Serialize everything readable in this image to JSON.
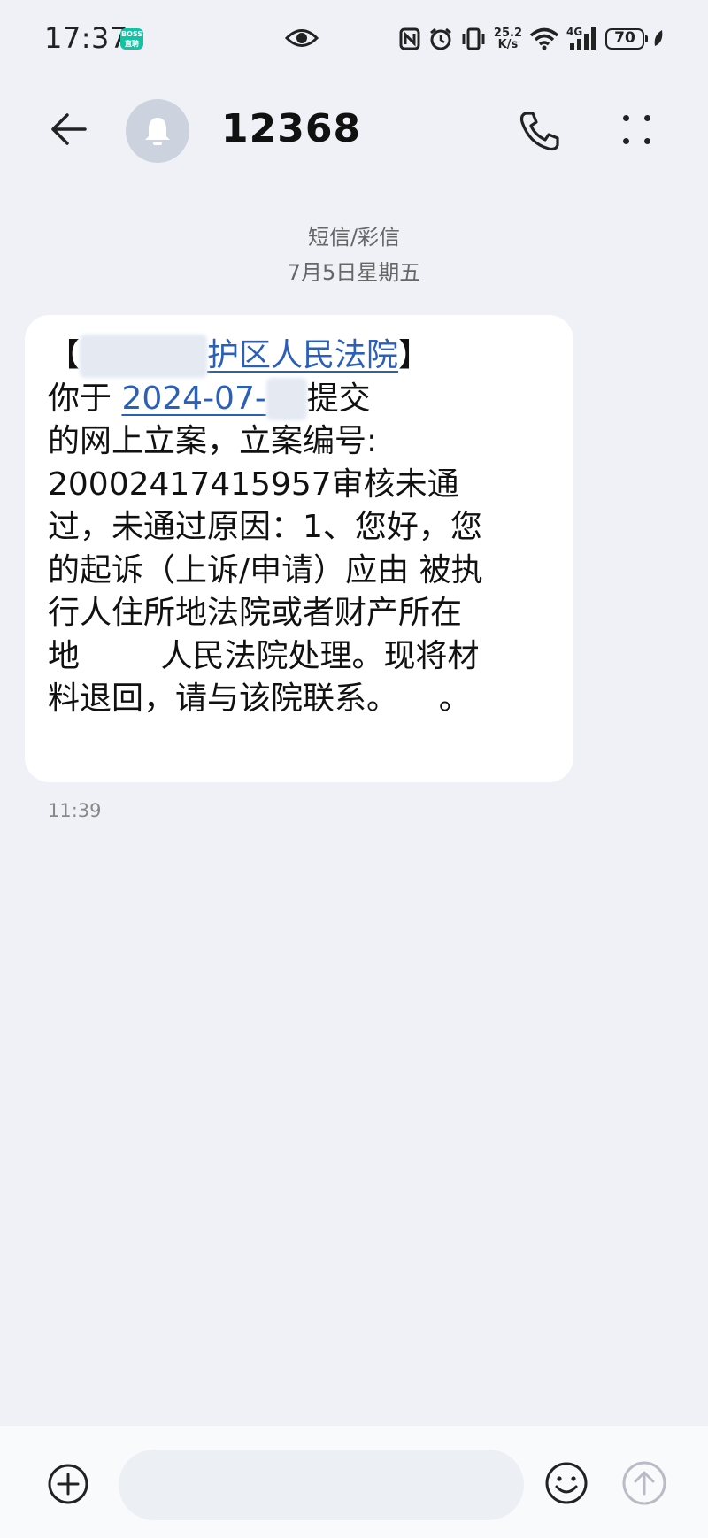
{
  "status_bar": {
    "time": "17:37",
    "app_badge": "BOSS\n直聘",
    "net_speed_value": "25.2",
    "net_speed_unit": "K/s",
    "network": "4G",
    "battery": "70"
  },
  "header": {
    "contact": "12368"
  },
  "conversation": {
    "type_label": "短信/彩信",
    "date_label": "7月5日星期五"
  },
  "message": {
    "line1_open": "【",
    "line1_court": "护区人民法院",
    "line1_close": "】",
    "line2_prefix": "你于 ",
    "line2_date": "2024-07-",
    "line2_suffix": "提交",
    "line3": "的网上立案，立案编号:",
    "line4": "20002417415957审核未通",
    "line5": "过，未通过原因：1、您好，您",
    "line6": "的起诉（上诉/申请）应由 被执",
    "line7": "行人住所地法院或者财产所在",
    "line8": "地        人民法院处理。现将材",
    "line9": "料退回，请与该院联系。    。",
    "time": "11:39"
  },
  "input": {
    "placeholder": ""
  },
  "icons": {
    "back": "back-arrow-icon",
    "avatar": "bell-icon",
    "call": "phone-icon",
    "more": "more-vertical-icon",
    "add": "plus-circle-icon",
    "emoji": "emoji-icon",
    "send": "send-arrow-icon"
  }
}
